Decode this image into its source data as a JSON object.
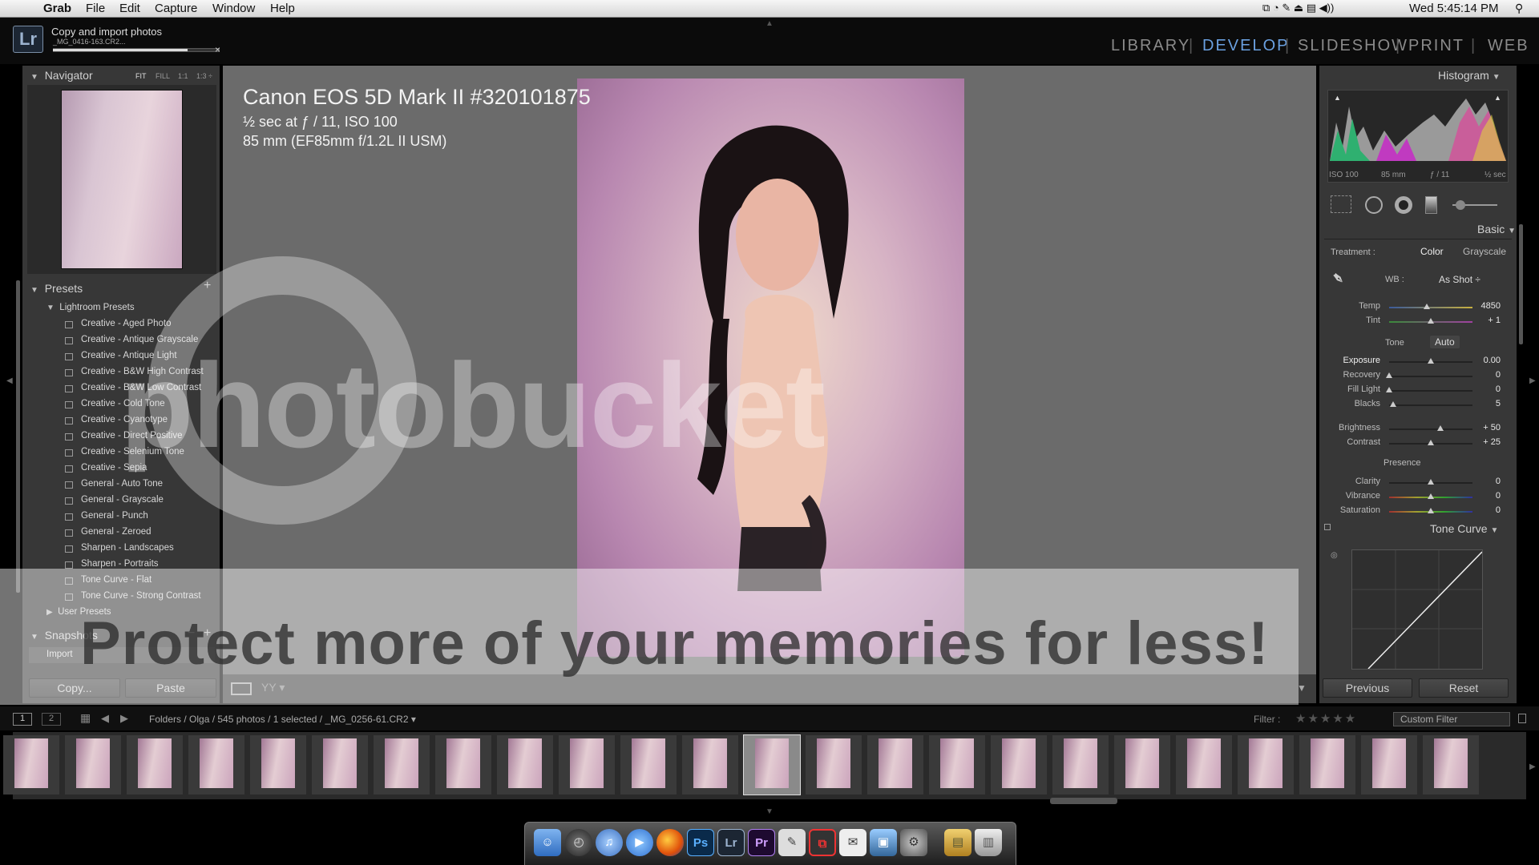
{
  "menubar": {
    "app_name": "Grab",
    "items": [
      "File",
      "Edit",
      "Capture",
      "Window",
      "Help"
    ],
    "clock": "Wed 5:45:14 PM"
  },
  "task": {
    "title": "Copy and import photos",
    "subtitle": "_MG_0416-163.CR2...",
    "progress": 0.81,
    "close": "×"
  },
  "logo": "Lr",
  "modules": [
    "LIBRARY",
    "DEVELOP",
    "SLIDESHOW",
    "PRINT",
    "WEB"
  ],
  "active_module": "DEVELOP",
  "active_color": "#6aa0e0",
  "left": {
    "navigator": {
      "title": "Navigator",
      "zoom": [
        "FIT",
        "FILL",
        "1:1",
        "1:3 ÷"
      ]
    },
    "presets": {
      "title": "Presets",
      "folder": "Lightroom Presets",
      "items": [
        "Creative - Aged Photo",
        "Creative - Antique Grayscale",
        "Creative - Antique Light",
        "Creative - B&W High Contrast",
        "Creative - B&W Low Contrast",
        "Creative - Cold Tone",
        "Creative - Cyanotype",
        "Creative - Direct Positive",
        "Creative - Selenium Tone",
        "Creative - Sepia",
        "General - Auto Tone",
        "General - Grayscale",
        "General - Punch",
        "General - Zeroed",
        "Sharpen - Landscapes",
        "Sharpen - Portraits",
        "Tone Curve - Flat",
        "Tone Curve - Strong Contrast"
      ],
      "user_folder": "User Presets"
    },
    "snapshots": {
      "title": "Snapshots",
      "items": [
        "Import"
      ]
    },
    "copy_label": "Copy...",
    "paste_label": "Paste"
  },
  "photo_info": {
    "camera": "Canon EOS 5D Mark II #320101875",
    "exposure": "½ sec at ƒ / 11, ISO 100",
    "lens": "85 mm (EF85mm f/1.2L II USM)"
  },
  "watermark": {
    "logo_text": "photobucket",
    "banner": "Protect more of your memories for less!"
  },
  "right": {
    "histogram": {
      "title": "Histogram",
      "iso": "ISO 100",
      "focal": "85 mm",
      "aperture": "ƒ / 11",
      "shutter": "½ sec"
    },
    "basic": {
      "title": "Basic",
      "treatment_label": "Treatment :",
      "treatment_color": "Color",
      "treatment_gray": "Grayscale",
      "wb_label": "WB :",
      "wb_value": "As Shot ÷",
      "tone_label": "Tone",
      "auto_label": "Auto",
      "presence_label": "Presence",
      "sliders": [
        {
          "label": "Temp",
          "value": "4850",
          "pos": 0.45
        },
        {
          "label": "Tint",
          "value": "+ 1",
          "pos": 0.5
        },
        {
          "label": "Exposure",
          "value": "0.00",
          "pos": 0.5
        },
        {
          "label": "Recovery",
          "value": "0",
          "pos": 0.0
        },
        {
          "label": "Fill Light",
          "value": "0",
          "pos": 0.0
        },
        {
          "label": "Blacks",
          "value": "5",
          "pos": 0.05
        },
        {
          "label": "Brightness",
          "value": "+ 50",
          "pos": 0.62
        },
        {
          "label": "Contrast",
          "value": "+ 25",
          "pos": 0.5
        },
        {
          "label": "Clarity",
          "value": "0",
          "pos": 0.5
        },
        {
          "label": "Vibrance",
          "value": "0",
          "pos": 0.5
        },
        {
          "label": "Saturation",
          "value": "0",
          "pos": 0.5
        }
      ]
    },
    "tone_curve_title": "Tone Curve",
    "previous_label": "Previous",
    "reset_label": "Reset"
  },
  "filmstrip": {
    "page1": "1",
    "page2": "2",
    "path": "Folders / Olga / 545 photos / 1 selected / _MG_0256-61.CR2 ▾",
    "filter_label": "Filter :",
    "filter_value": "Custom Filter",
    "count": 24,
    "selected_index": 12
  },
  "dock": {
    "icons": [
      "finder-icon",
      "dashboard-icon",
      "itunes-icon",
      "ichat-icon",
      "firefox-icon",
      "photoshop-icon",
      "lightroom-icon",
      "premiere-icon",
      "script-editor-icon",
      "remote-desktop-icon",
      "mail-icon",
      "iphoto-icon",
      "system-preferences-icon",
      "documents-stack-icon",
      "trash-icon"
    ],
    "ps_label": "Ps",
    "lr_label": "Lr",
    "pr_label": "Pr"
  }
}
